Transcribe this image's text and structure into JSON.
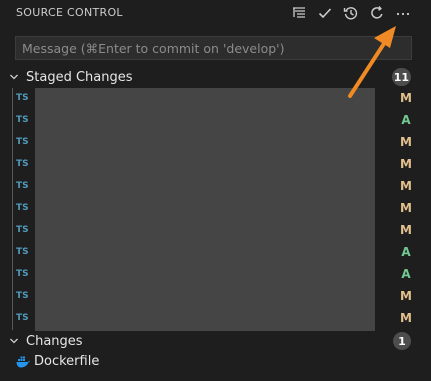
{
  "header": {
    "title": "SOURCE CONTROL",
    "toolbar": [
      {
        "name": "view-as-tree-icon"
      },
      {
        "name": "commit-check-icon"
      },
      {
        "name": "history-icon"
      },
      {
        "name": "refresh-icon"
      },
      {
        "name": "more-actions-icon"
      }
    ]
  },
  "commit": {
    "placeholder": "Message (⌘Enter to commit on 'develop')"
  },
  "staged": {
    "label": "Staged Changes",
    "count": "11",
    "files": [
      {
        "lang": "TS",
        "status": "M"
      },
      {
        "lang": "TS",
        "status": "A"
      },
      {
        "lang": "TS",
        "status": "M"
      },
      {
        "lang": "TS",
        "status": "M"
      },
      {
        "lang": "TS",
        "status": "M"
      },
      {
        "lang": "TS",
        "status": "M"
      },
      {
        "lang": "TS",
        "status": "M"
      },
      {
        "lang": "TS",
        "status": "A"
      },
      {
        "lang": "TS",
        "status": "A"
      },
      {
        "lang": "TS",
        "status": "M"
      },
      {
        "lang": "TS",
        "status": "M"
      }
    ]
  },
  "changes": {
    "label": "Changes",
    "count": "1",
    "files": [
      {
        "name": "Dockerfile",
        "icon": "docker-icon"
      }
    ]
  },
  "colors": {
    "modified": "#e2c08d",
    "added": "#73c991",
    "ts_badge": "#519aba",
    "annotation_arrow": "#f08a24"
  }
}
